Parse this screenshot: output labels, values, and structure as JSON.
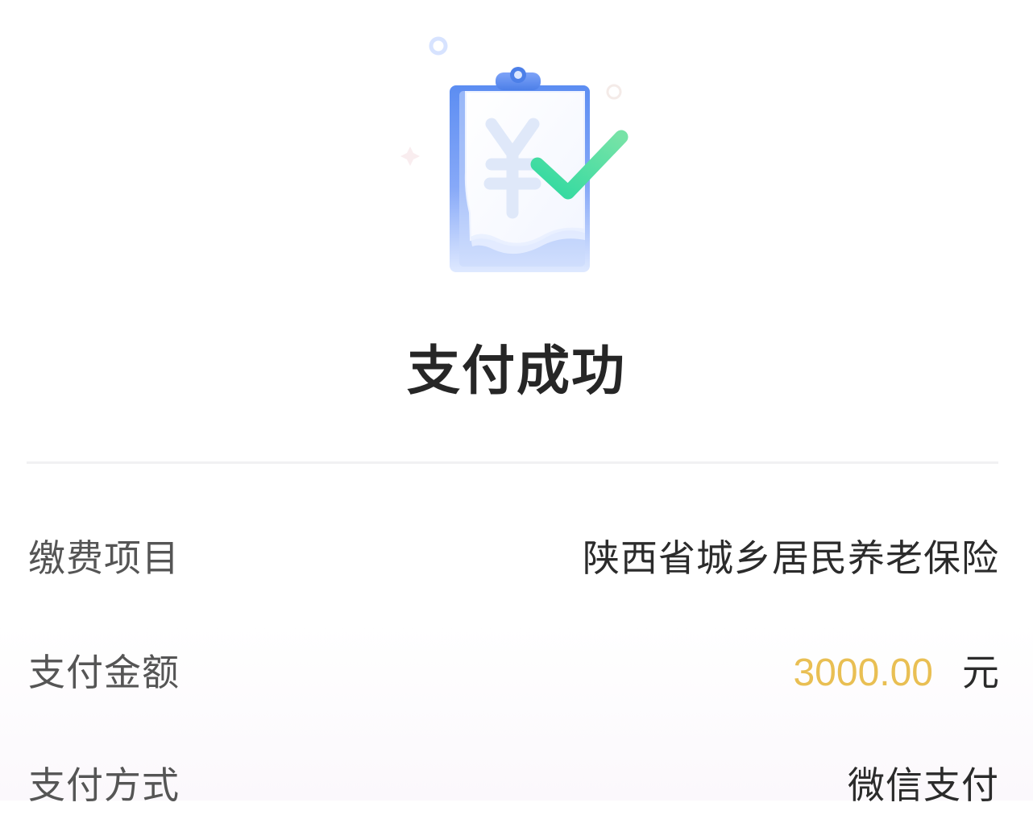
{
  "result": {
    "title": "支付成功"
  },
  "details": {
    "item_label": "缴费项目",
    "item_value": "陕西省城乡居民养老保险",
    "amount_label": "支付金额",
    "amount_value": "3000.00",
    "amount_unit": "元",
    "method_label": "支付方式",
    "method_value": "微信支付"
  },
  "icons": {
    "status": "payment-success-clipboard-check-icon"
  },
  "colors": {
    "title": "#262626",
    "label": "#555555",
    "value": "#2b2b2b",
    "amount": "#e9bf53",
    "divider": "#f1f1f3",
    "check_gradient_start": "#2ed9a0",
    "clipboard_blue": "#6c9df7"
  }
}
